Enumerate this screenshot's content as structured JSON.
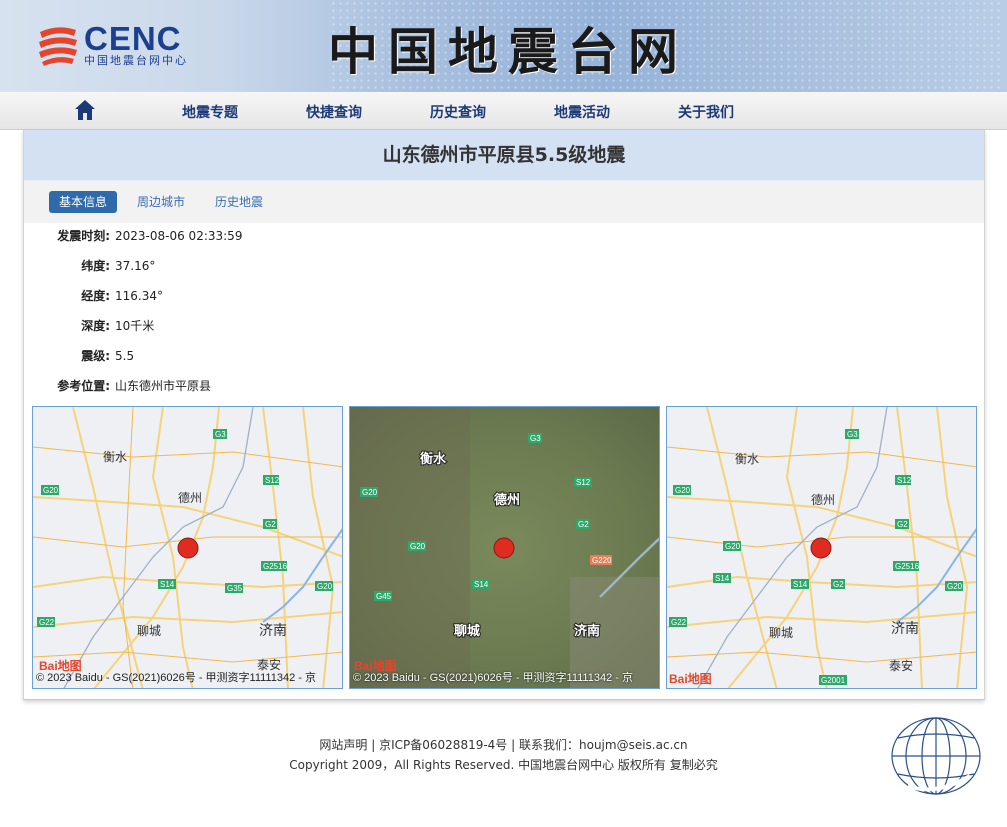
{
  "header": {
    "logo_text": "CENC",
    "logo_sub": "中国地震台网中心",
    "site_title": "中国地震台网"
  },
  "nav": {
    "home_icon": "home-icon",
    "items": [
      "地震专题",
      "快捷查询",
      "历史查询",
      "地震活动",
      "关于我们"
    ]
  },
  "event": {
    "title": "山东德州市平原县5.5级地震",
    "tabs": [
      "基本信息",
      "周边城市",
      "历史地震"
    ],
    "fields": [
      {
        "label": "发震时刻:",
        "value": "2023-08-06 02:33:59"
      },
      {
        "label": "纬度:",
        "value": "37.16°"
      },
      {
        "label": "经度:",
        "value": "116.34°"
      },
      {
        "label": "深度:",
        "value": "10千米"
      },
      {
        "label": "震级:",
        "value": "5.5"
      },
      {
        "label": "参考位置:",
        "value": "山东德州市平原县"
      }
    ]
  },
  "maps": {
    "copyright": "© 2023 Baidu - GS(2021)6026号 - 甲测资字11111342 - 京",
    "brand": "Bai地图",
    "map1": {
      "cities": [
        "衡水",
        "德州",
        "聊城",
        "济南",
        "泰安"
      ],
      "roads": [
        "G3",
        "G20",
        "S12",
        "G2",
        "G2516",
        "S14",
        "G35",
        "G20",
        "G22"
      ]
    },
    "map2": {
      "cities": [
        "衡水",
        "德州",
        "聊城",
        "济南"
      ],
      "roads": [
        "G3",
        "S12",
        "G20",
        "G2",
        "G20",
        "G220",
        "S14",
        "G45"
      ]
    },
    "map3": {
      "cities": [
        "衡水",
        "德州",
        "聊城",
        "济南",
        "泰安"
      ],
      "roads": [
        "G3",
        "G20",
        "S12",
        "G2",
        "G20",
        "G2516",
        "S14",
        "S14",
        "G2",
        "G20",
        "G22",
        "G2001"
      ]
    }
  },
  "footer": {
    "links": [
      "网站声明",
      "京ICP备06028819-4号",
      "联系我们：houjm@seis.ac.cn"
    ],
    "copyright": "Copyright 2009，All Rights Reserved. 中国地震台网中心 版权所有 复制必究"
  },
  "colors": {
    "nav_text": "#1d3a78",
    "tab_active": "#2f6aab",
    "title_bar": "#d3e1f3",
    "epicenter": "#e02b20"
  }
}
